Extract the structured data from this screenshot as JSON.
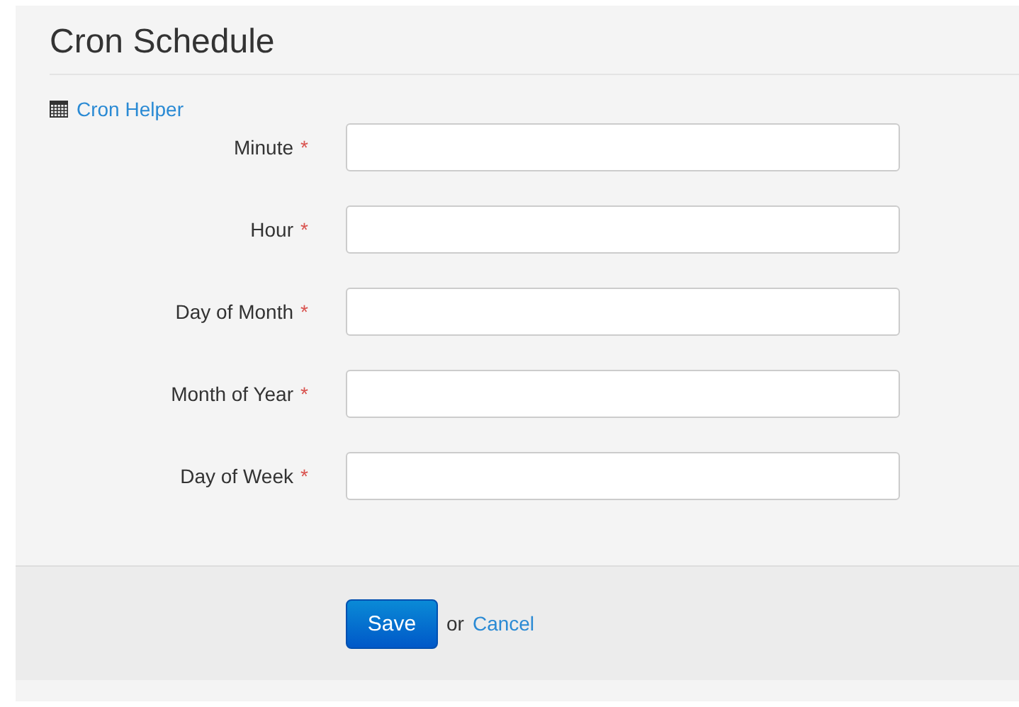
{
  "page": {
    "title": "Cron Schedule",
    "helper_link": "Cron Helper"
  },
  "fields": [
    {
      "label": "Minute",
      "required_mark": "*"
    },
    {
      "label": "Hour",
      "required_mark": "*"
    },
    {
      "label": "Day of Month",
      "required_mark": "*"
    },
    {
      "label": "Month of Year",
      "required_mark": "*"
    },
    {
      "label": "Day of Week",
      "required_mark": "*"
    }
  ],
  "actions": {
    "save": "Save",
    "separator": "or",
    "cancel": "Cancel"
  }
}
